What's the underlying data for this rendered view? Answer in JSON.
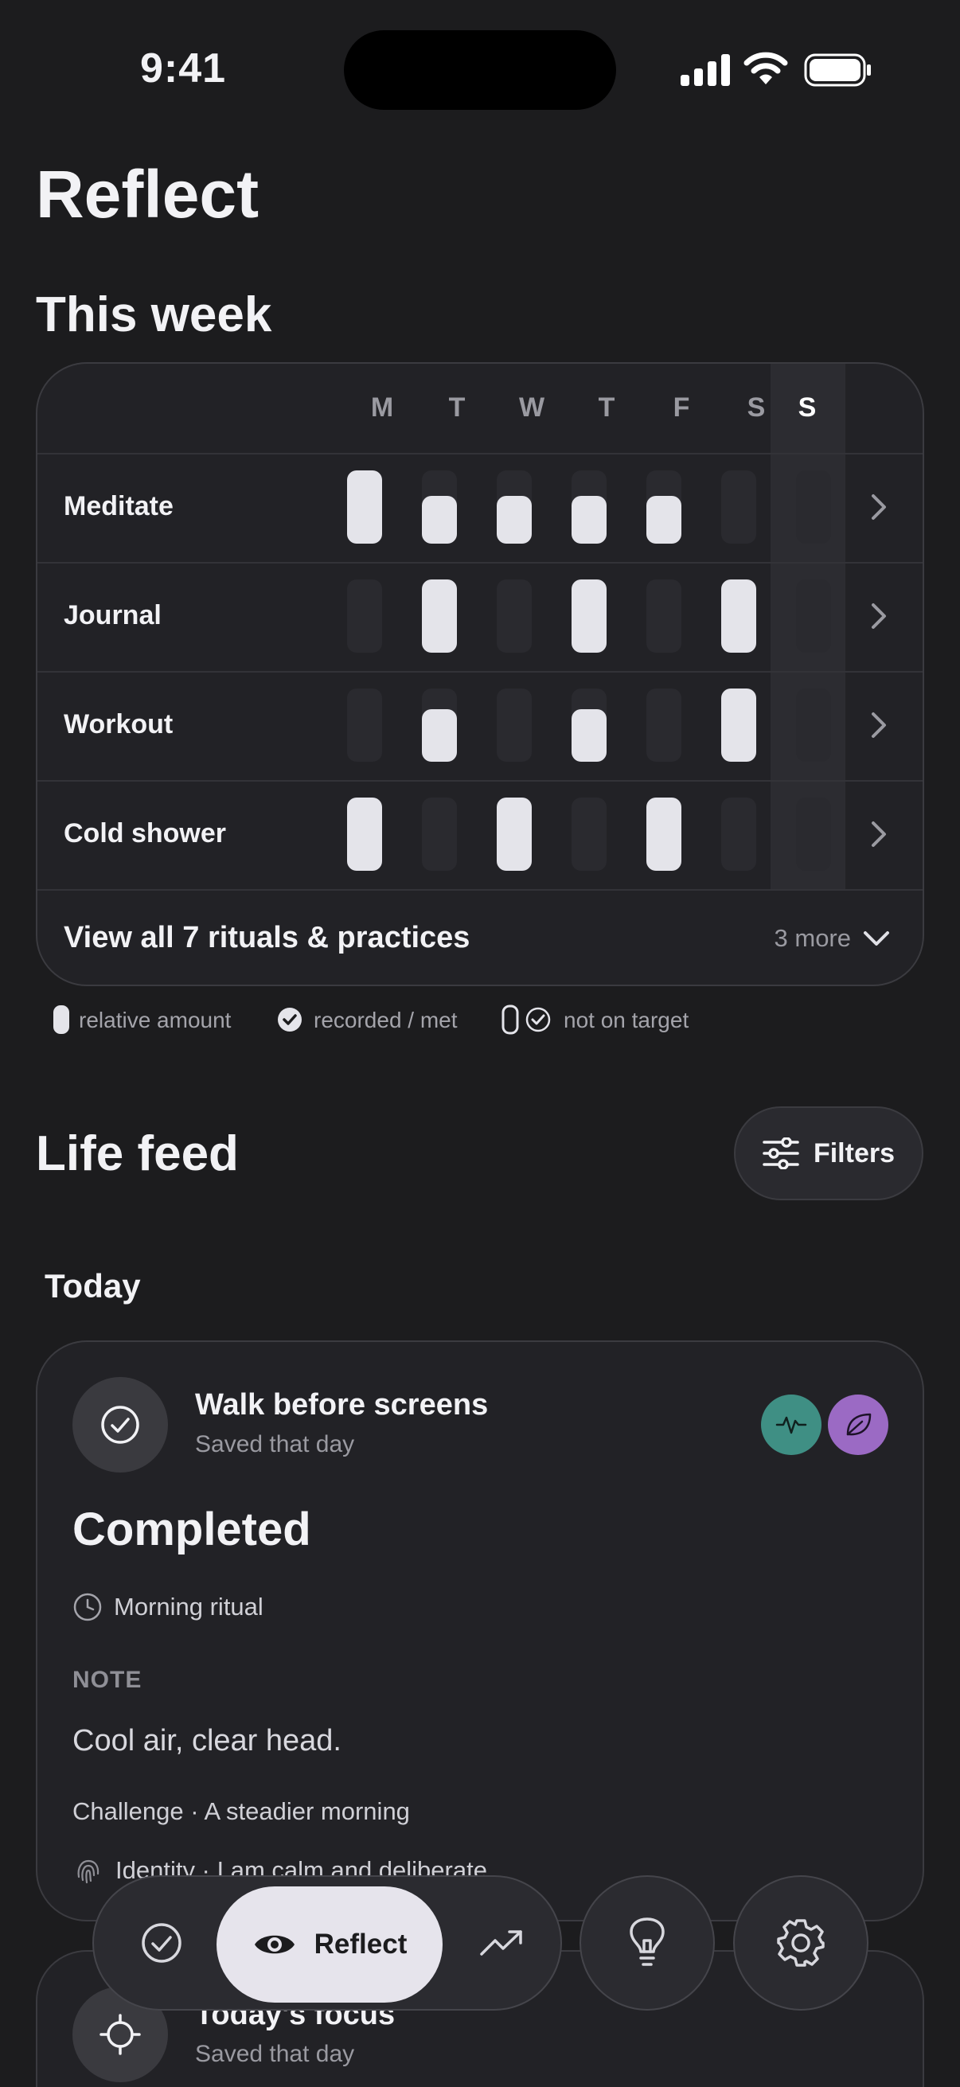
{
  "status_bar": {
    "time": "9:41"
  },
  "page": {
    "title": "Reflect"
  },
  "week": {
    "title": "This week",
    "days": [
      "M",
      "T",
      "W",
      "T",
      "F",
      "S",
      "S"
    ],
    "today_index": 6,
    "rows": [
      {
        "label": "Meditate",
        "levels": [
          1.0,
          0.65,
          0.65,
          0.65,
          0.65,
          0,
          0
        ]
      },
      {
        "label": "Journal",
        "levels": [
          0,
          1.0,
          0,
          1.0,
          0,
          1.0,
          0
        ]
      },
      {
        "label": "Workout",
        "levels": [
          0,
          0.72,
          0,
          0.72,
          0,
          1.0,
          0
        ]
      },
      {
        "label": "Cold shower",
        "levels": [
          1.0,
          0,
          1.0,
          0,
          1.0,
          0,
          0
        ]
      }
    ],
    "view_all_label": "View all 7 rituals & practices",
    "more_label": "3 more"
  },
  "legend": {
    "relative_amount": "relative amount",
    "recorded": "recorded / met",
    "not_on_target": "not on target"
  },
  "feed": {
    "title": "Life feed",
    "filters_label": "Filters",
    "today_label": "Today",
    "entry": {
      "title": "Walk before screens",
      "subtitle": "Saved that day",
      "status": "Completed",
      "ritual": "Morning ritual",
      "note_label": "NOTE",
      "note_text": "Cool air, clear head.",
      "challenge": "Challenge · A steadier morning",
      "identity": "Identity · I am calm and deliberate",
      "badge_colors": [
        "#3f8f84",
        "#9b6ac4"
      ]
    },
    "entry2": {
      "title": "Today's focus",
      "subtitle": "Saved that day"
    }
  },
  "nav": {
    "active_label": "Reflect",
    "icons": [
      "check-circle-icon",
      "eye-icon",
      "trend-up-icon",
      "lightbulb-icon",
      "gear-icon"
    ]
  },
  "colors": {
    "background": "#1c1c1e",
    "card": "#222226",
    "bar": "#e4e4ea",
    "accent_pill": "#e6e4ec"
  }
}
